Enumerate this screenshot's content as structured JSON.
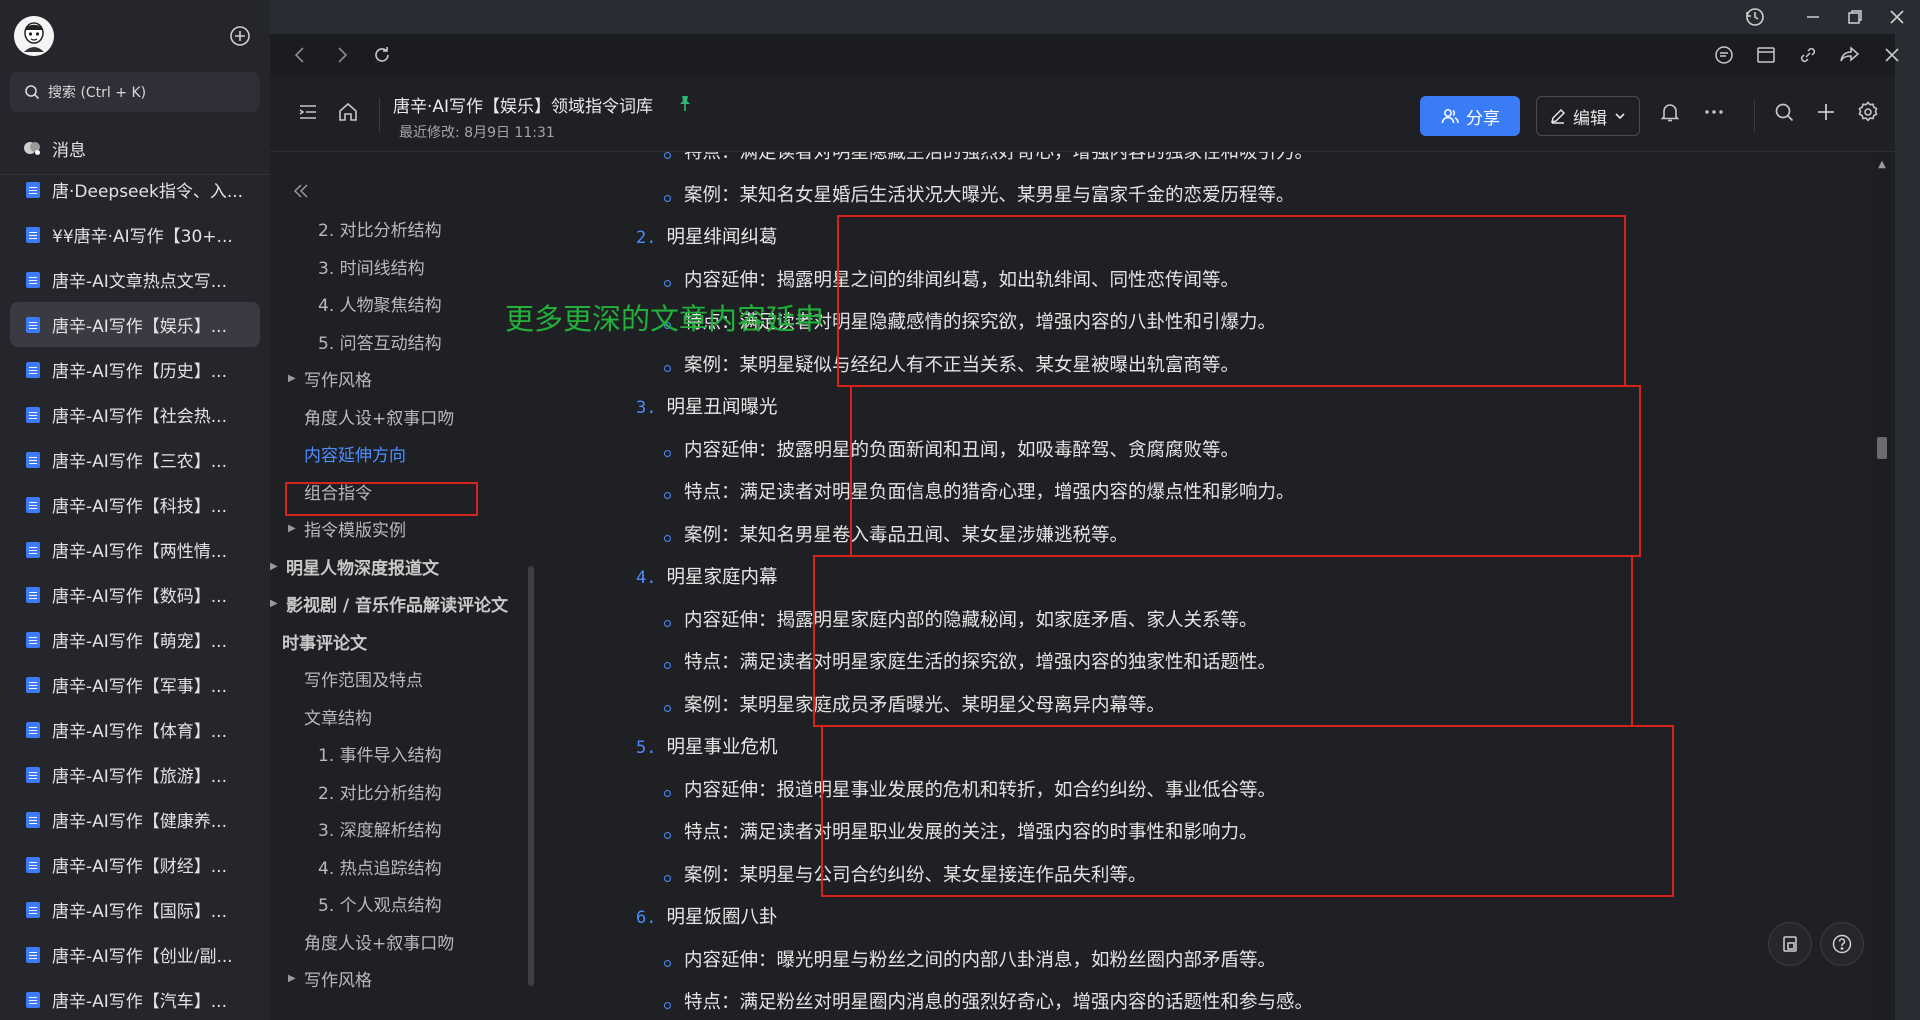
{
  "window_controls": {
    "icons": [
      "history-icon",
      "minimize-icon",
      "restore-icon",
      "close-icon"
    ]
  },
  "sidebar": {
    "search": {
      "placeholder": "搜索 (Ctrl + K)"
    },
    "messages_label": "消息",
    "docs": [
      {
        "label": "唐·Deepseek指令、入..."
      },
      {
        "label": "¥¥唐辛·AI写作【30+..."
      },
      {
        "label": "唐辛-AI文章热点文写..."
      },
      {
        "label": "唐辛-AI写作【娱乐】...",
        "active": true
      },
      {
        "label": "唐辛-AI写作【历史】..."
      },
      {
        "label": "唐辛-AI写作【社会热..."
      },
      {
        "label": "唐辛-AI写作【三农】..."
      },
      {
        "label": "唐辛-AI写作【科技】..."
      },
      {
        "label": "唐辛-AI写作【两性情..."
      },
      {
        "label": "唐辛-AI写作【数码】..."
      },
      {
        "label": "唐辛-AI写作【萌宠】..."
      },
      {
        "label": "唐辛-AI写作【军事】..."
      },
      {
        "label": "唐辛-AI写作【体育】..."
      },
      {
        "label": "唐辛-AI写作【旅游】..."
      },
      {
        "label": "唐辛-AI写作【健康养..."
      },
      {
        "label": "唐辛-AI写作【财经】..."
      },
      {
        "label": "唐辛-AI写作【国际】..."
      },
      {
        "label": "唐辛-AI写作【创业/副..."
      },
      {
        "label": "唐辛-AI写作【汽车】..."
      }
    ]
  },
  "header": {
    "title": "唐辛·AI写作【娱乐】领域指令词库",
    "modified": "最近修改: 8月9日 11:31",
    "share_label": "分享",
    "edit_label": "编辑"
  },
  "outline": {
    "items": [
      {
        "label": "2. 对比分析结构",
        "level": 3
      },
      {
        "label": "3. 时间线结构",
        "level": 3
      },
      {
        "label": "4. 人物聚焦结构",
        "level": 3
      },
      {
        "label": "5. 问答互动结构",
        "level": 3
      },
      {
        "label": "写作风格",
        "level": 2,
        "caret": true
      },
      {
        "label": "角度人设+叙事口吻",
        "level": 2
      },
      {
        "label": "内容延伸方向",
        "level": 2,
        "active": true
      },
      {
        "label": "组合指令",
        "level": 2
      },
      {
        "label": "指令模版实例",
        "level": 2,
        "caret": true
      },
      {
        "label": "明星人物深度报道文",
        "level": 1,
        "caret": true,
        "bold": true
      },
      {
        "label": "影视剧 / 音乐作品解读评论文",
        "level": 1,
        "caret": true,
        "bold": true
      },
      {
        "label": "时事评论文",
        "level": 1,
        "bold": true
      },
      {
        "label": "写作范围及特点",
        "level": 2
      },
      {
        "label": "文章结构",
        "level": 2
      },
      {
        "label": "1. 事件导入结构",
        "level": 3
      },
      {
        "label": "2. 对比分析结构",
        "level": 3
      },
      {
        "label": "3. 深度解析结构",
        "level": 3
      },
      {
        "label": "4. 热点追踪结构",
        "level": 3
      },
      {
        "label": "5. 个人观点结构",
        "level": 3
      },
      {
        "label": "角度人设+叙事口吻",
        "level": 2
      },
      {
        "label": "写作风格",
        "level": 2,
        "caret": true
      }
    ]
  },
  "content": {
    "overlay_note": "更多更深的文章内容延申",
    "intro_bullets": [
      "特点：满足读者对明星隐藏生活的强烈好奇心，增强内容的独家性和吸引力。",
      "案例：某知名女星婚后生活状况大曝光、某男星与富家千金的恋爱历程等。"
    ],
    "sections": [
      {
        "number": "2.",
        "title": "明星绯闻纠葛",
        "bullets": [
          "内容延伸：揭露明星之间的绯闻纠葛，如出轨绯闻、同性恋传闻等。",
          "特点：满足读者对明星隐藏感情的探究欲，增强内容的八卦性和引爆力。",
          "案例：某明星疑似与经纪人有不正当关系、某女星被曝出轨富商等。"
        ]
      },
      {
        "number": "3.",
        "title": "明星丑闻曝光",
        "bullets": [
          "内容延伸：披露明星的负面新闻和丑闻，如吸毒醉驾、贪腐腐败等。",
          "特点：满足读者对明星负面信息的猎奇心理，增强内容的爆点性和影响力。",
          "案例：某知名男星卷入毒品丑闻、某女星涉嫌逃税等。"
        ]
      },
      {
        "number": "4.",
        "title": "明星家庭内幕",
        "bullets": [
          "内容延伸：揭露明星家庭内部的隐藏秘闻，如家庭矛盾、家人关系等。",
          "特点：满足读者对明星家庭生活的探究欲，增强内容的独家性和话题性。",
          "案例：某明星家庭成员矛盾曝光、某明星父母离异内幕等。"
        ]
      },
      {
        "number": "5.",
        "title": "明星事业危机",
        "bullets": [
          "内容延伸：报道明星事业发展的危机和转折，如合约纠纷、事业低谷等。",
          "特点：满足读者对明星职业发展的关注，增强内容的时事性和影响力。",
          "案例：某明星与公司合约纠纷、某女星接连作品失利等。"
        ]
      },
      {
        "number": "6.",
        "title": "明星饭圈八卦",
        "bullets": [
          "内容延伸：曝光明星与粉丝之间的内部八卦消息，如粉丝圈内部矛盾等。",
          "特点：满足粉丝对明星圈内消息的强烈好奇心，增强内容的话题性和参与感。"
        ]
      }
    ]
  },
  "colors": {
    "accent": "#3a7cf5",
    "link": "#4c8dff",
    "annotation_red": "#d8231c",
    "annotation_green": "#22b03a",
    "pin_green": "#2bb673"
  }
}
